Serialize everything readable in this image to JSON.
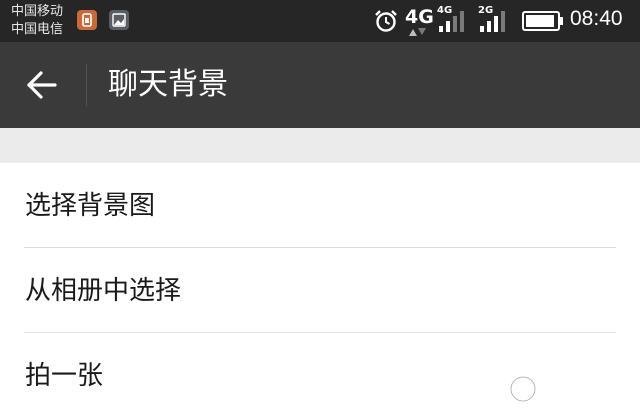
{
  "status_bar": {
    "carrier_1": "中国移动",
    "carrier_2": "中国电信",
    "network_1": "4G",
    "network_1_small": "4G",
    "network_2_small": "2G",
    "time": "08:40"
  },
  "header": {
    "title": "聊天背景"
  },
  "menu": {
    "items": [
      {
        "label": "选择背景图"
      },
      {
        "label": "从相册中选择"
      },
      {
        "label": "拍一张"
      }
    ]
  },
  "colors": {
    "status_bar_bg": "#262626",
    "action_bar_bg": "#3a3a3a",
    "band_bg": "#ebebeb",
    "text": "#1a1a1a"
  }
}
